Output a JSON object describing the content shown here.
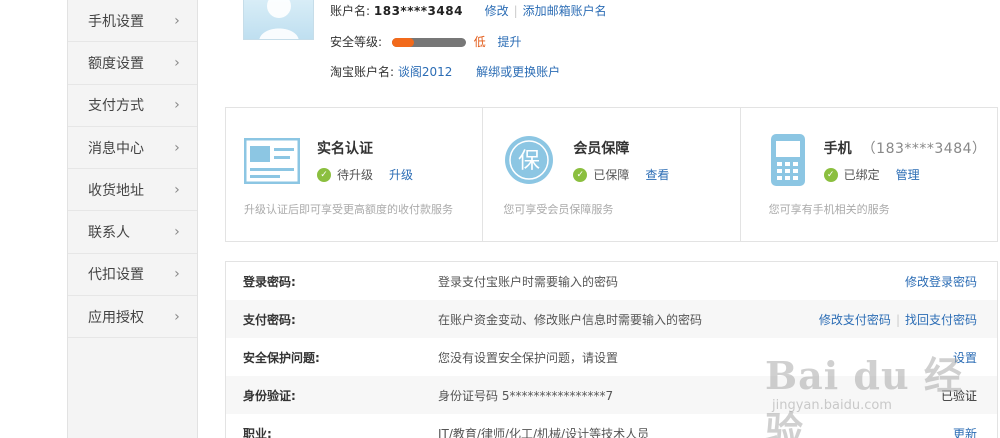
{
  "sidebar": {
    "items": [
      {
        "label": "手机设置"
      },
      {
        "label": "额度设置"
      },
      {
        "label": "支付方式"
      },
      {
        "label": "消息中心"
      },
      {
        "label": "收货地址"
      },
      {
        "label": "联系人"
      },
      {
        "label": "代扣设置"
      },
      {
        "label": "应用授权"
      }
    ],
    "chevron": "›"
  },
  "account": {
    "name_label": "账户名:",
    "name_value": "183****3484",
    "modify_link": "修改",
    "add_email_link": "添加邮箱账户名",
    "security_label": "安全等级:",
    "security_level_text": "低",
    "security_level_fraction": 0.3,
    "upgrade_link": "提升",
    "taobao_label": "淘宝账户名:",
    "taobao_value": "谈阁2012",
    "unbind_link": "解绑或更换账户"
  },
  "panels": [
    {
      "title": "实名认证",
      "status": "待升级",
      "action": "升级",
      "desc": "升级认证后即可享受更高额度的收付款服务",
      "icon": "id-card-icon"
    },
    {
      "title": "会员保障",
      "status": "已保障",
      "action": "查看",
      "desc": "您可享受会员保障服务",
      "icon": "insurance-icon"
    },
    {
      "title": "手机",
      "title_extra": "（183****3484）",
      "status": "已绑定",
      "action": "管理",
      "desc": "您可享有手机相关的服务",
      "icon": "phone-icon"
    }
  ],
  "settings": [
    {
      "name": "登录密码:",
      "desc": "登录支付宝账户时需要输入的密码",
      "actions": [
        "修改登录密码"
      ]
    },
    {
      "name": "支付密码:",
      "desc": "在账户资金变动、修改账户信息时需要输入的密码",
      "actions": [
        "修改支付密码",
        "找回支付密码"
      ]
    },
    {
      "name": "安全保护问题:",
      "desc": "您没有设置安全保护问题，请设置",
      "actions": [
        "设置"
      ]
    },
    {
      "name": "身份验证:",
      "desc": "身份证号码 5****************7",
      "status": "已验证"
    },
    {
      "name": "职业:",
      "desc": "IT/教育/律师/化工/机械/设计等技术人员",
      "actions": [
        "更新"
      ]
    }
  ],
  "watermark": {
    "brand": "Bai du 经验",
    "url": "jingyan.baidu.com"
  },
  "colors": {
    "link": "#2c6db5",
    "meter_fill": "#f26a1b",
    "check": "#8bbf3f",
    "icon": "#8cc6e3"
  }
}
